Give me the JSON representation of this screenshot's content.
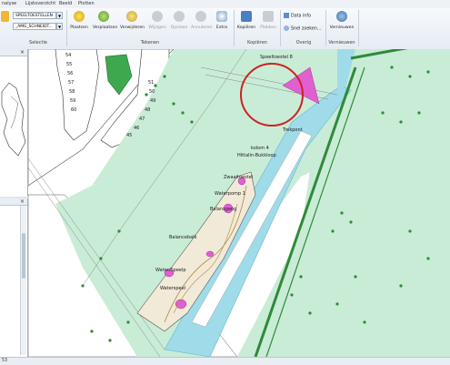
{
  "menu": [
    "nalyse",
    "Lijstoverzicht",
    "Beeld",
    "Plotten"
  ],
  "selectie": {
    "combo1": "SPEELTOESTELLEN",
    "combo2": "_AMG_SCHNEIDT...",
    "label": "Selectie"
  },
  "tekenen": {
    "label": "Tekenen",
    "buttons": [
      "Plaatsen",
      "Verplaatsen",
      "Verwijderen",
      "Wijzigen",
      "Opslaan",
      "Annuleren",
      "Extra"
    ]
  },
  "kopieren": {
    "label": "Kopiëren",
    "buttons": [
      "Kopiëren",
      "Plakken"
    ]
  },
  "overig": {
    "label": "Overig",
    "buttons": [
      "Data info",
      "Snel zoeken..."
    ]
  },
  "verniewen": {
    "label": "Vernieuwen",
    "button": "Vernieuwen"
  },
  "map_labels": {
    "speeltoestel_title": "Speeltoestel 8",
    "kolom": "kolom 4",
    "tekst1": "Hittalin-Bukkloop",
    "tekst2": "Zwaaitoestel",
    "tekst3": "Waterpomp 1",
    "tekst4": "Balancebalk",
    "tekst5": "Water/Speelp",
    "tekst6": "Waterspeel",
    "tekst7": "Trekpont",
    "tekst8": "Balansgang",
    "house_numbers": [
      "54",
      "55",
      "56",
      "57",
      "58",
      "59",
      "60",
      "51",
      "50",
      "49",
      "48",
      "47",
      "46",
      "45"
    ]
  },
  "status": {
    "left": "53"
  },
  "colors": {
    "water": "#9fdbe9",
    "grass": "#c9ecd6",
    "road": "#ffffff",
    "highlight": "#cc2222",
    "play_area": "#f2ead8"
  }
}
